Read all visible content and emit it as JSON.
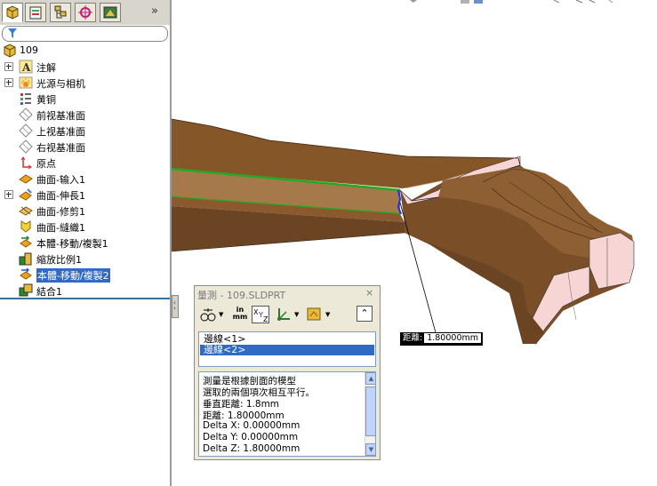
{
  "feature_tree": {
    "root": {
      "label": "109",
      "icon": "part-icon"
    },
    "items": [
      {
        "label": "注解",
        "icon": "annotations-icon",
        "expandable": true
      },
      {
        "label": "光源与相机",
        "icon": "lights-cameras-icon",
        "expandable": true
      },
      {
        "label": "黄铜",
        "icon": "material-icon",
        "expandable": false
      },
      {
        "label": "前视基准面",
        "icon": "plane-icon",
        "expandable": false
      },
      {
        "label": "上视基准面",
        "icon": "plane-icon",
        "expandable": false
      },
      {
        "label": "右视基准面",
        "icon": "plane-icon",
        "expandable": false
      },
      {
        "label": "原点",
        "icon": "origin-icon",
        "expandable": false
      },
      {
        "label": "曲面-输入1",
        "icon": "surface-import-icon",
        "expandable": false
      },
      {
        "label": "曲面-伸長1",
        "icon": "surface-extend-icon",
        "expandable": true
      },
      {
        "label": "曲面-修剪1",
        "icon": "surface-trim-icon",
        "expandable": false
      },
      {
        "label": "曲面-縫織1",
        "icon": "surface-knit-icon",
        "expandable": false
      },
      {
        "label": "本體-移動/複製1",
        "icon": "move-copy-icon",
        "expandable": false
      },
      {
        "label": "縮放比例1",
        "icon": "scale-icon",
        "expandable": false
      },
      {
        "label": "本體-移動/複製2",
        "icon": "move-copy-icon",
        "expandable": false,
        "selected": true
      },
      {
        "label": "結合1",
        "icon": "combine-icon",
        "expandable": false
      }
    ]
  },
  "tabs": {
    "items": [
      "feature-manager-tab",
      "property-manager-tab",
      "configuration-manager-tab",
      "dimxpert-tab",
      "display-manager-tab"
    ],
    "more_label": "»"
  },
  "measure_dialog": {
    "title": "量測 - 109.SLDPRT",
    "close_label": "×",
    "units_label_top": "in",
    "units_label_bottom": "mm",
    "collapse_label": "⌃",
    "selections": [
      {
        "label": "邊線<1>",
        "selected": false
      },
      {
        "label": "邊線<2>",
        "selected": true
      }
    ],
    "results": [
      "測量是根據剖面的模型",
      "選取的兩個項次相互平行。",
      "垂直距離: 1.8mm",
      "距離: 1.80000mm",
      "Delta X: 0.00000mm",
      "Delta Y: 0.00000mm",
      "Delta Z: 1.80000mm"
    ]
  },
  "callout": {
    "label": "距離:",
    "value": "1.80000mm"
  },
  "colors": {
    "model_top": "#8b5a2b",
    "model_side": "#6b4423",
    "model_section": "#f7d5d5",
    "highlight_edge": "#22aa22",
    "selection": "#316ac5"
  }
}
